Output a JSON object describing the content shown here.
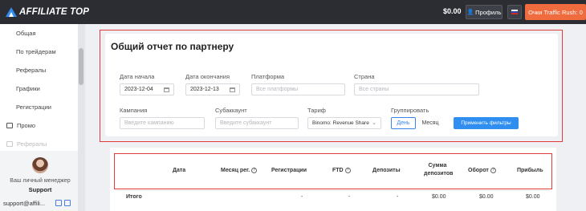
{
  "header": {
    "logo_text": "AFFILIATE TOP",
    "balance": "$0.00",
    "profile_label": "Профиль",
    "rush_label": "Очки Traffic Rush: 0",
    "accent": "#f06b3d"
  },
  "sidebar": {
    "items": [
      {
        "label": "Общая"
      },
      {
        "label": "По трейдерам"
      },
      {
        "label": "Рефералы"
      },
      {
        "label": "Графики"
      },
      {
        "label": "Регистрации"
      }
    ],
    "promo_label": "Промо",
    "faded_label": "Рефералы",
    "manager_label": "Ваш личный менеджер",
    "manager_name": "Support",
    "manager_email": "support@affili..."
  },
  "filters": {
    "title": "Общий отчет по партнеру",
    "start_label": "Дата начала",
    "start_value": "2023-12-04",
    "end_label": "Дата окончания",
    "end_value": "2023-12-13",
    "platform_label": "Платформа",
    "platform_placeholder": "Все платформы",
    "country_label": "Страна",
    "country_placeholder": "Все страны",
    "campaign_label": "Кампания",
    "campaign_placeholder": "Введите кампанию",
    "subaccount_label": "Субаккаунт",
    "subaccount_placeholder": "Введите субаккаунт",
    "tariff_label": "Тариф",
    "tariff_value": "Binomo: Revenue Share",
    "group_label": "Группировать",
    "group_day": "День",
    "group_month": "Месяц",
    "apply_label": "Применить фильтры"
  },
  "table": {
    "headers": [
      "Дата",
      "Месяц рег.",
      "Регистрации",
      "FTD",
      "Депозиты",
      "Сумма",
      "депозитов",
      "Оборот",
      "Прибыль"
    ],
    "total_row": [
      "Итого",
      "-",
      "-",
      "-",
      "$0.00",
      "$0.00",
      "$0.00"
    ]
  }
}
